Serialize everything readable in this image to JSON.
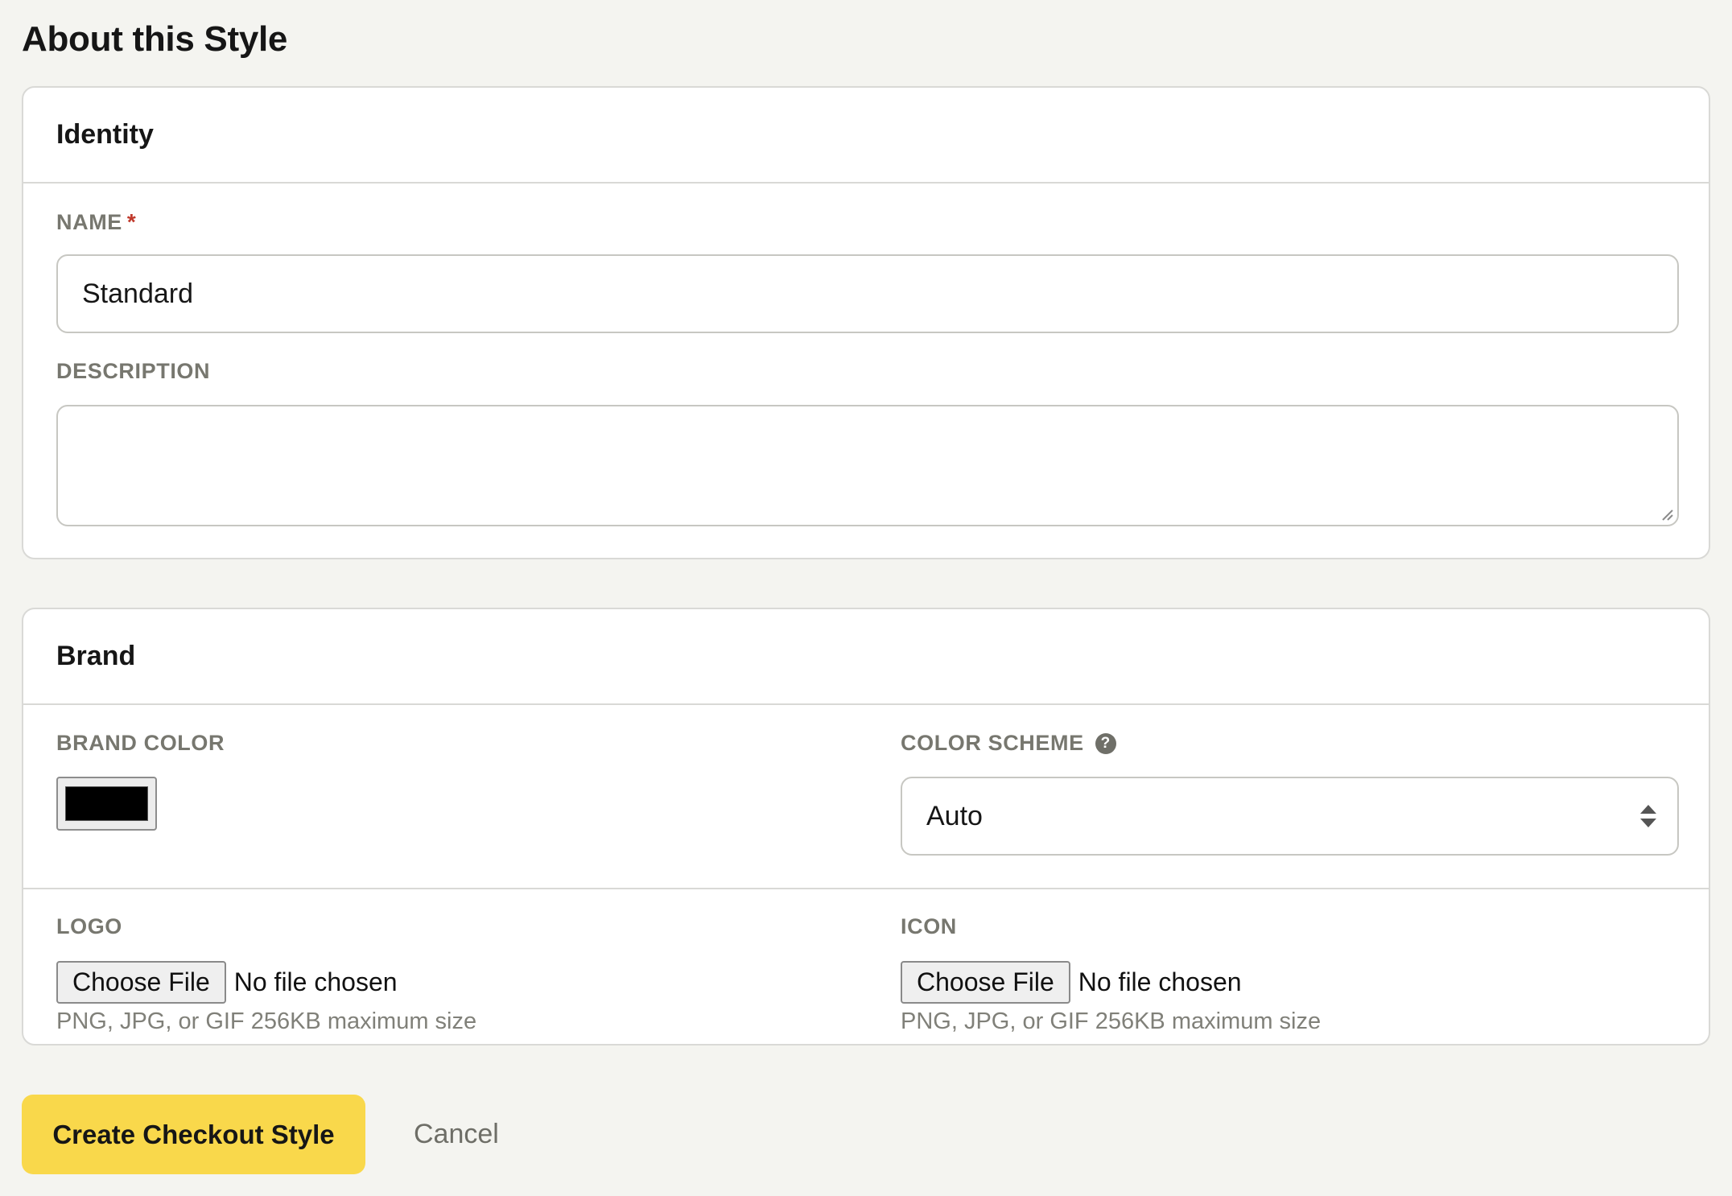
{
  "page": {
    "title": "About this Style"
  },
  "identity": {
    "header": "Identity",
    "name_label": "NAME",
    "name_required": "*",
    "name_value": "Standard",
    "description_label": "DESCRIPTION",
    "description_value": ""
  },
  "brand": {
    "header": "Brand",
    "brand_color_label": "BRAND COLOR",
    "brand_color_value": "#000000",
    "color_scheme_label": "COLOR SCHEME",
    "color_scheme_help_icon": "question-circle-icon",
    "color_scheme_value": "Auto",
    "logo_label": "LOGO",
    "icon_label": "ICON",
    "choose_file_label": "Choose File",
    "no_file_text": "No file chosen",
    "file_hint": "PNG, JPG, or GIF 256KB maximum size"
  },
  "actions": {
    "create_label": "Create Checkout Style",
    "cancel_label": "Cancel"
  },
  "colors": {
    "background": "#f4f4f0",
    "primary_button": "#f9d84b",
    "required": "#c0392b",
    "label": "#77776f"
  }
}
